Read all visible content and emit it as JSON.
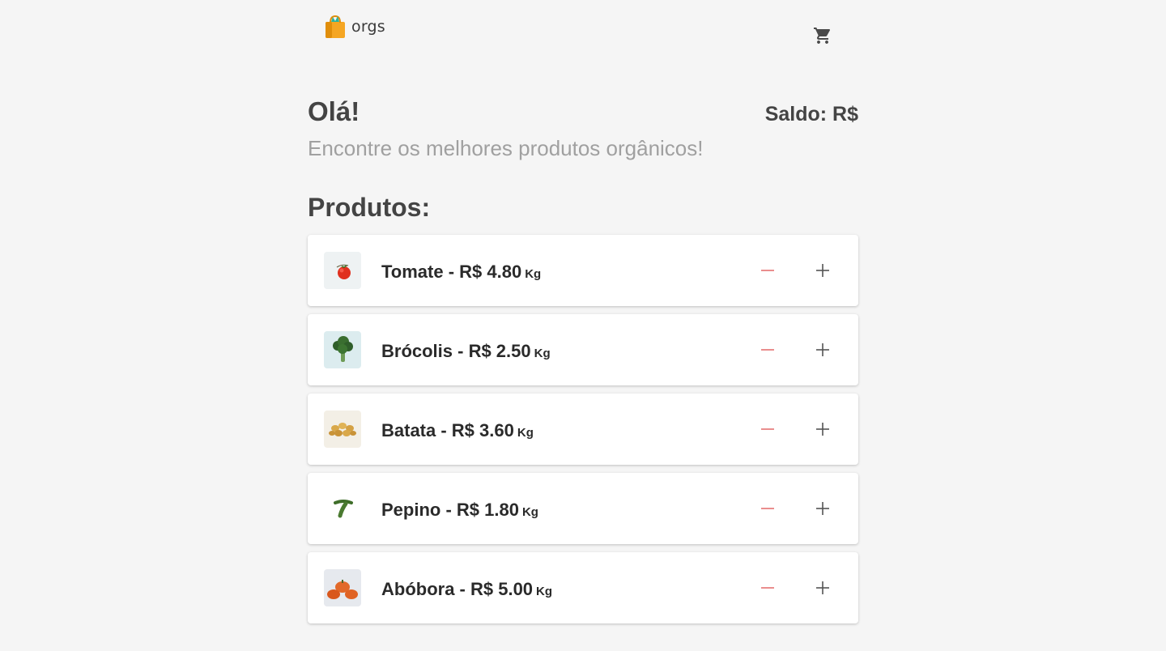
{
  "header": {
    "logo_text": "orgs",
    "logo_icon": "shopping-bag-icon",
    "cart_icon": "shopping-cart-icon"
  },
  "main": {
    "greeting": "Olá!",
    "balance_label": "Saldo: R$",
    "subtitle": "Encontre os melhores produtos orgânicos!",
    "section_title": "Produtos:"
  },
  "products": [
    {
      "name": "Tomate - R$ 4.80",
      "unit": "Kg",
      "icon": "tomato-icon"
    },
    {
      "name": "Brócolis - R$ 2.50",
      "unit": "Kg",
      "icon": "broccoli-icon"
    },
    {
      "name": "Batata - R$ 3.60",
      "unit": "Kg",
      "icon": "potato-icon"
    },
    {
      "name": "Pepino - R$ 1.80",
      "unit": "Kg",
      "icon": "cucumber-icon"
    },
    {
      "name": "Abóbora - R$ 5.00",
      "unit": "Kg",
      "icon": "pumpkin-icon"
    }
  ],
  "colors": {
    "minus": "#e57373",
    "plus": "#555555",
    "heading": "#444444",
    "subtitle": "#a0a0a0"
  }
}
